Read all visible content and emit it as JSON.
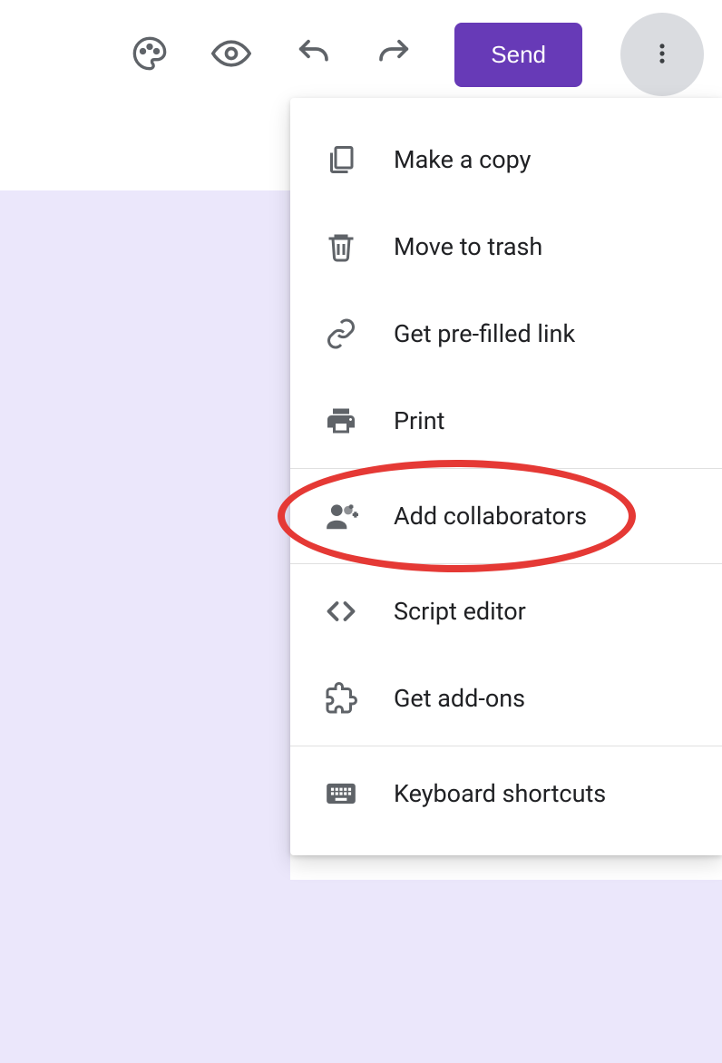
{
  "toolbar": {
    "send_label": "Send"
  },
  "menu": {
    "items": [
      {
        "label": "Make a copy"
      },
      {
        "label": "Move to trash"
      },
      {
        "label": "Get pre-filled link"
      },
      {
        "label": "Print"
      },
      {
        "label": "Add collaborators"
      },
      {
        "label": "Script editor"
      },
      {
        "label": "Get add-ons"
      },
      {
        "label": "Keyboard shortcuts"
      }
    ]
  },
  "annotation": {
    "highlighted_item": "Add collaborators"
  }
}
